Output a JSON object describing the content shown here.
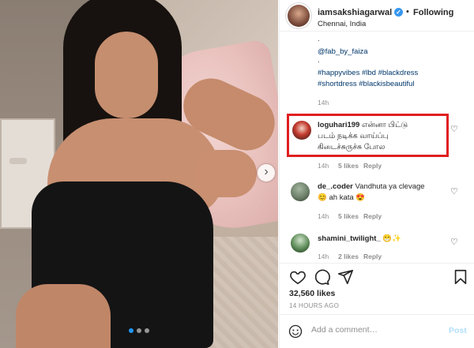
{
  "post": {
    "header": {
      "username": "iamsakshiagarwal",
      "separator": "•",
      "follow_label": "Following",
      "location": "Chennai, India"
    },
    "caption": {
      "dot1": ".",
      "mention": "@fab_by_faiza",
      "dot2": ".",
      "hashtags_line1": "#happyvibes #lbd #blackdress",
      "hashtags_line2": "#shortdress #blackisbeautiful",
      "age": "14h"
    },
    "comments": [
      {
        "username": "loguhari199",
        "text": "என்னா பிட்டு படம் நடிக்க வாய்ப்பு கிடைச்சுருச்சு போல",
        "line1": "என்னா பிட்டு",
        "line2": "படம் நடிக்க வாய்ப்பு",
        "line3": "கிடைச்சுருச்சு போல",
        "age": "14h",
        "likes": "5 likes",
        "reply": "Reply"
      },
      {
        "username": "de_.coder",
        "text": "Vandhuta ya clevage",
        "text2": "ah kata",
        "age": "14h",
        "likes": "5 likes",
        "reply": "Reply"
      },
      {
        "username": "shamini_twilight_",
        "text": "",
        "age": "14h",
        "likes": "2 likes",
        "reply": "Reply"
      }
    ],
    "like_count": "32,560 likes",
    "timestamp": "14 HOURS AGO",
    "comment_box": {
      "placeholder": "Add a comment…",
      "post_label": "Post"
    },
    "carousel": {
      "slide_count": 3,
      "active_index": 0
    }
  },
  "icons": [
    "verified-icon",
    "heart-icon",
    "comment-icon",
    "share-icon",
    "bookmark-icon",
    "emoji-icon",
    "carousel-next-icon"
  ],
  "colors": {
    "link": "#00376b",
    "verified": "#3897f0",
    "highlight": "#e01f1f",
    "post_button": "#b2dffc",
    "carousel_active": "#2196f3"
  }
}
